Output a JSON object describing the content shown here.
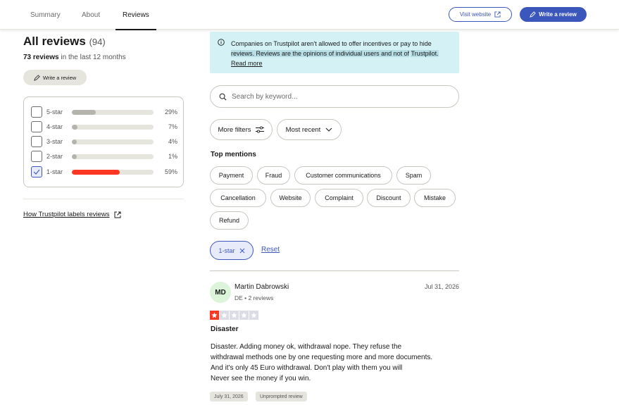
{
  "nav": {
    "tabs": [
      "Summary",
      "About",
      "Reviews"
    ],
    "visit_website": "Visit website",
    "write_review": "Write a review"
  },
  "left": {
    "title": "All reviews",
    "total": "(94)",
    "recent_count": "73 reviews",
    "recent_suffix": "in the last 12 months",
    "write_review": "Write a review",
    "distribution": [
      {
        "label": "5-star",
        "percent": 29,
        "pct_text": "29%",
        "checked": false
      },
      {
        "label": "4-star",
        "percent": 7,
        "pct_text": "7%",
        "checked": false
      },
      {
        "label": "3-star",
        "percent": 4,
        "pct_text": "4%",
        "checked": false
      },
      {
        "label": "2-star",
        "percent": 1,
        "pct_text": "1%",
        "checked": false
      },
      {
        "label": "1-star",
        "percent": 59,
        "pct_text": "59%",
        "checked": true
      }
    ],
    "labels_link": "How Trustpilot labels reviews"
  },
  "notice": {
    "text_a": "Companies on Trustpilot aren't allowed to offer incentives or pay to hide",
    "text_b": "reviews. Reviews are the opinions of individual users and not of",
    "text_c": "Trustpilot.",
    "read_more": "Read more"
  },
  "search": {
    "placeholder": "Search by keyword..."
  },
  "filters": {
    "more": "More filters",
    "sort": "Most recent"
  },
  "mentions": {
    "title": "Top mentions",
    "chips": [
      "Payment",
      "Fraud",
      "Customer communications",
      "Spam",
      "Cancellation",
      "Website",
      "Complaint",
      "Discount",
      "Mistake",
      "Refund"
    ]
  },
  "active_filter": {
    "label": "1-star",
    "reset": "Reset"
  },
  "review": {
    "initials": "MD",
    "name": "Martin Dabrowski",
    "meta": "DE • 2 reviews",
    "date": "Jul 31, 2026",
    "rating": 1,
    "title": "Disaster",
    "body": [
      "Disaster. Adding money ok, withdrawal nope. They refuse the",
      "withdrawal methods one by one requesting more and more documents.",
      "And it's only 45 Euro withdrawal. Don't play with them you will",
      "Never see the money if you win."
    ],
    "tags": [
      "July 31, 2026",
      "Unprompted review"
    ]
  },
  "colors": {
    "brand_blue": "#3c57bc",
    "one_star_red": "#ff3722",
    "bar_gray": "#b4b4ad",
    "notice_bg": "#d4f2f5",
    "star_empty": "#dcdce6"
  }
}
